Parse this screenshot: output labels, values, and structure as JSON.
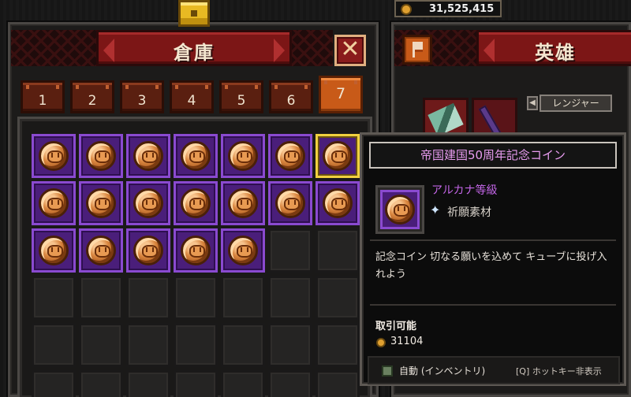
{
  "currency": {
    "gold_amount": "31,525,415",
    "icon": "gold-coin-icon"
  },
  "warehouse": {
    "title": "倉庫",
    "close_icon": "close-x-icon",
    "tabs": [
      {
        "label": "1",
        "active": false
      },
      {
        "label": "2",
        "active": false
      },
      {
        "label": "3",
        "active": false
      },
      {
        "label": "4",
        "active": false
      },
      {
        "label": "5",
        "active": false
      },
      {
        "label": "6",
        "active": false
      },
      {
        "label": "7",
        "active": true
      }
    ],
    "grid": {
      "columns": 7,
      "rows": 6,
      "filled_count": 19,
      "selected_index": 6,
      "item_icon": "commemorative-coin-icon"
    }
  },
  "hero": {
    "title": "英雄",
    "class_selector": "レンジャー",
    "flag_icon": "flag-icon"
  },
  "tooltip": {
    "item_name": "帝国建国50周年記念コイン",
    "rarity": "アルカナ等級",
    "type": "祈願素材",
    "type_icon": "sparkle-icon",
    "description": "記念コイン 切なる願いを込めて キューブに投げ入れよう",
    "trade_label": "取引可能",
    "price": "31104",
    "price_icon": "gold-coin-icon"
  },
  "hints": {
    "auto_label": "自動 (インベントリ)",
    "hotkey_label": "[Q] ホットキー非表示"
  },
  "colors": {
    "banner_red": "#7c1616",
    "rarity_purple": "#c466e8",
    "item_name_pink": "#e89cf0",
    "slot_purple": "#4a1e7a",
    "selection_yellow": "#f0d040",
    "active_tab_orange": "#c85a18"
  }
}
